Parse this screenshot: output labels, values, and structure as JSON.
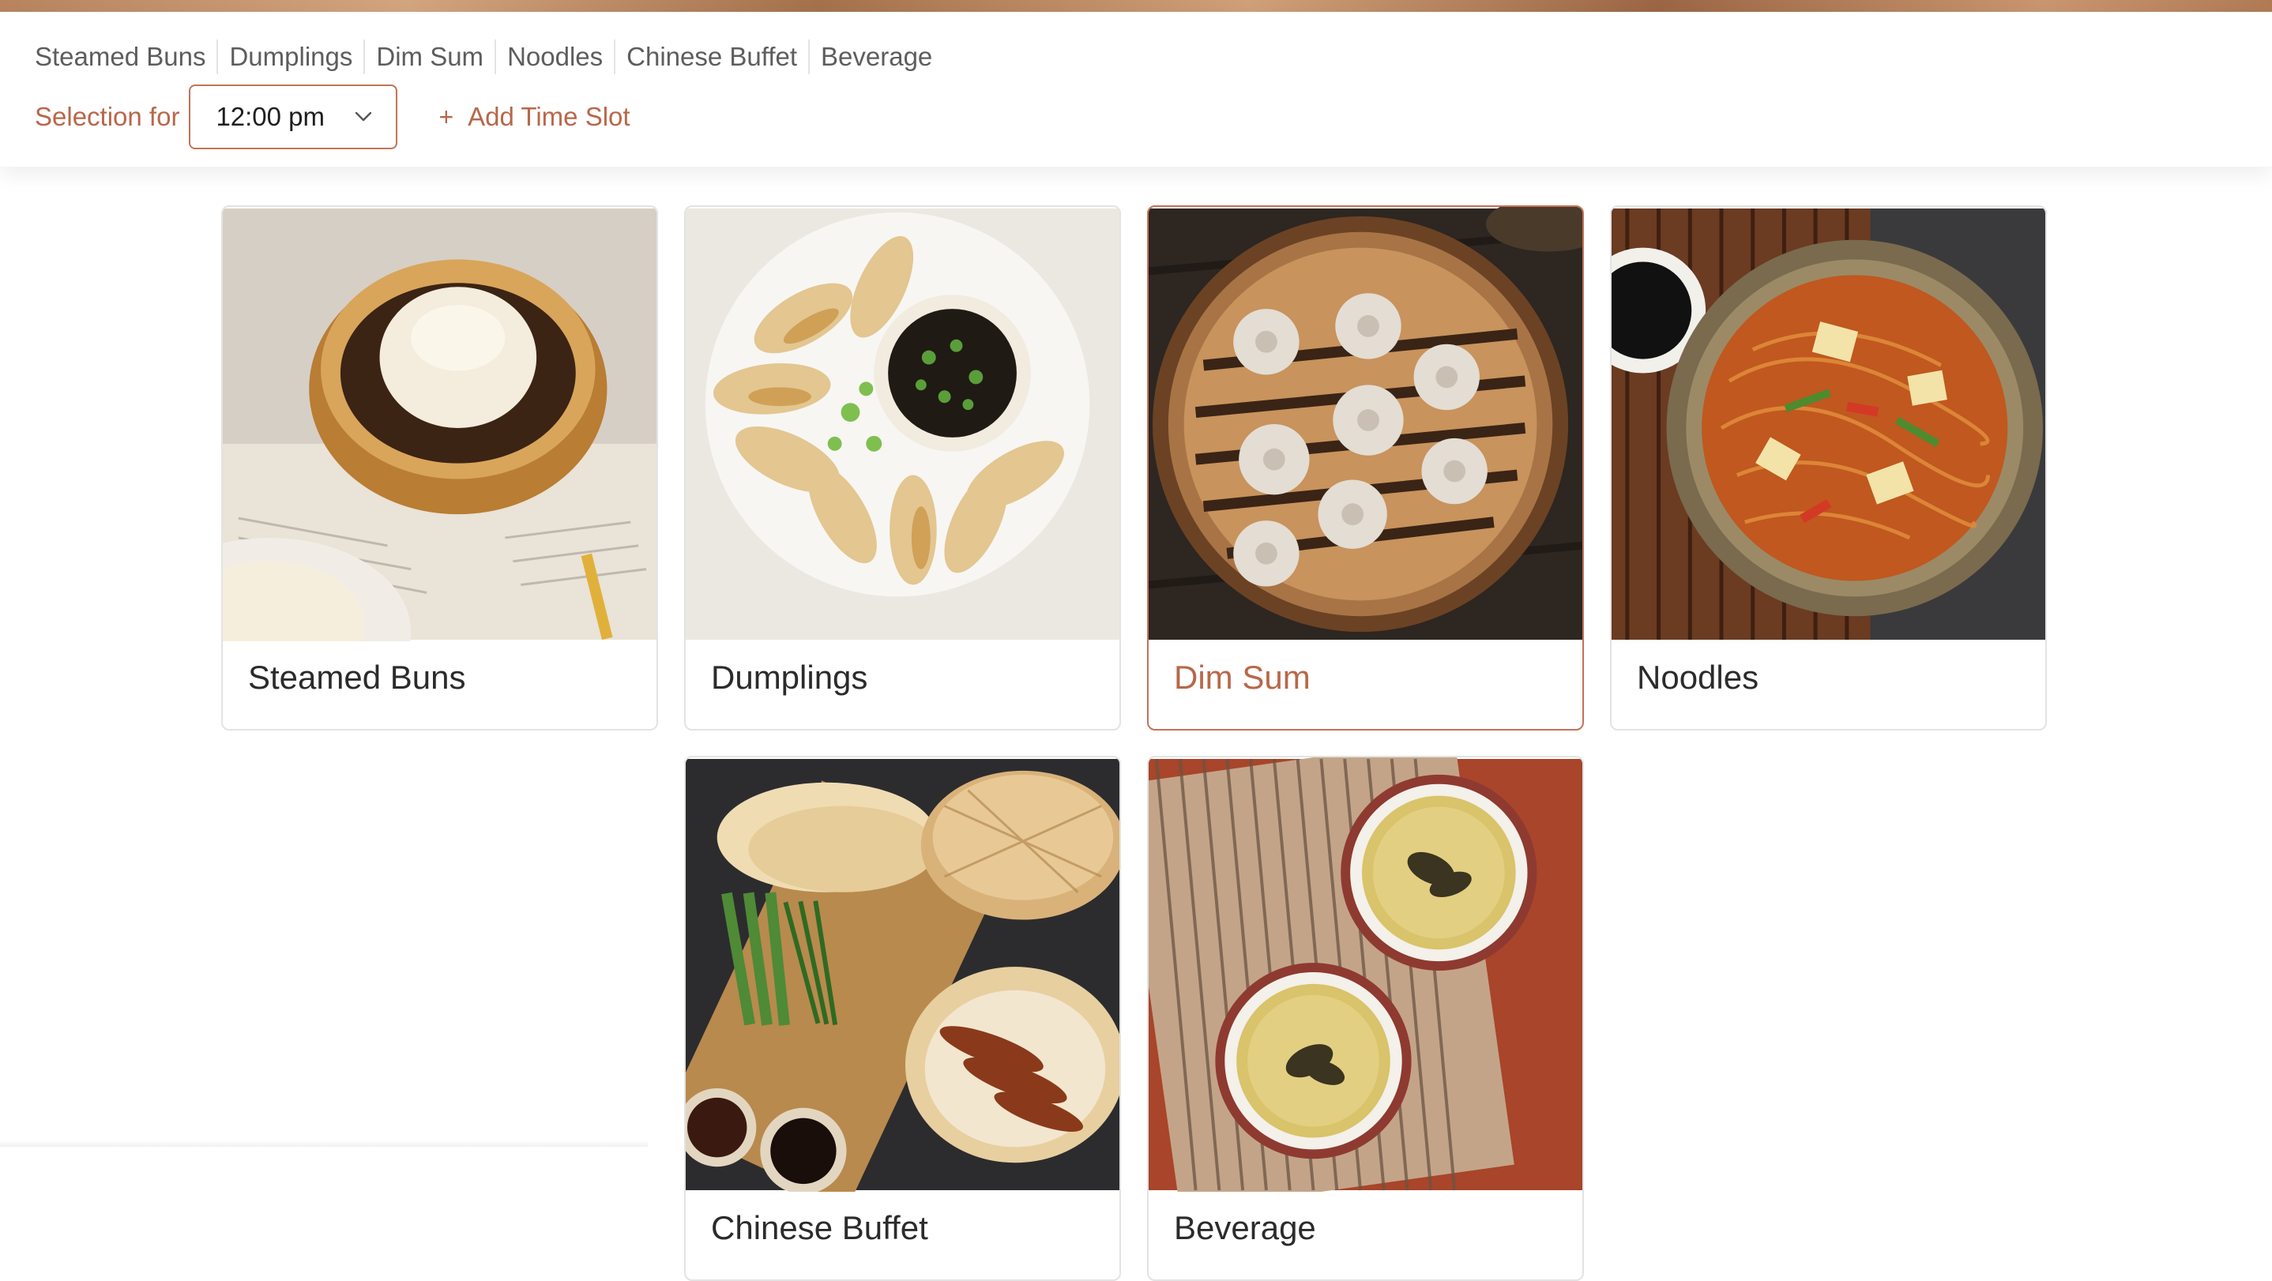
{
  "category_nav": {
    "items": [
      {
        "label": "Steamed Buns"
      },
      {
        "label": "Dumplings"
      },
      {
        "label": "Dim Sum"
      },
      {
        "label": "Noodles"
      },
      {
        "label": "Chinese Buffet"
      },
      {
        "label": "Beverage"
      }
    ]
  },
  "time_slot": {
    "label": "Selection for",
    "selected": "12:00 pm",
    "add_label": "Add Time Slot",
    "add_icon": "plus-icon",
    "dropdown_icon": "chevron-down-icon"
  },
  "categories": [
    {
      "name": "Steamed Buns",
      "selected": false
    },
    {
      "name": "Dumplings",
      "selected": false
    },
    {
      "name": "Dim Sum",
      "selected": true
    },
    {
      "name": "Noodles",
      "selected": false
    },
    {
      "name": "Chinese Buffet",
      "selected": false
    },
    {
      "name": "Beverage",
      "selected": false
    }
  ],
  "colors": {
    "accent": "#b8674a",
    "accent_border": "#c2735a",
    "nav_text": "#5d5d5d",
    "card_border": "#e3e3e3"
  }
}
